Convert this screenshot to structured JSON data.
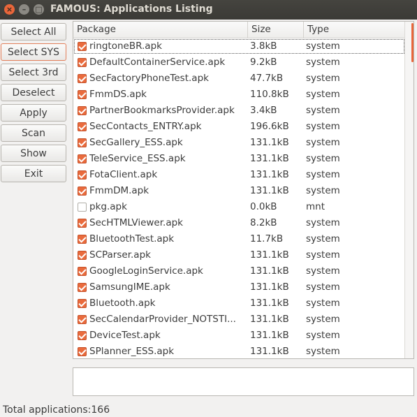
{
  "window": {
    "title": "FAMOUS: Applications Listing",
    "close_glyph": "×",
    "minimize_glyph": "–",
    "maximize_glyph": "□"
  },
  "buttons": [
    {
      "id": "select-all",
      "label": "Select All"
    },
    {
      "id": "select-sys",
      "label": "Select SYS"
    },
    {
      "id": "select-3rd",
      "label": "Select 3rd"
    },
    {
      "id": "deselect",
      "label": "Deselect"
    },
    {
      "id": "apply",
      "label": "Apply"
    },
    {
      "id": "scan",
      "label": "Scan"
    },
    {
      "id": "show",
      "label": "Show"
    },
    {
      "id": "exit",
      "label": "Exit"
    }
  ],
  "table": {
    "columns": [
      "Package",
      "Size",
      "Type"
    ],
    "rows": [
      {
        "checked": true,
        "package": "ringtoneBR.apk",
        "size": "3.8kB",
        "type": "system"
      },
      {
        "checked": true,
        "package": "DefaultContainerService.apk",
        "size": "9.2kB",
        "type": "system"
      },
      {
        "checked": true,
        "package": "SecFactoryPhoneTest.apk",
        "size": "47.7kB",
        "type": "system"
      },
      {
        "checked": true,
        "package": "FmmDS.apk",
        "size": "110.8kB",
        "type": "system"
      },
      {
        "checked": true,
        "package": "PartnerBookmarksProvider.apk",
        "size": "3.4kB",
        "type": "system"
      },
      {
        "checked": true,
        "package": "SecContacts_ENTRY.apk",
        "size": "196.6kB",
        "type": "system"
      },
      {
        "checked": true,
        "package": "SecGallery_ESS.apk",
        "size": "131.1kB",
        "type": "system"
      },
      {
        "checked": true,
        "package": "TeleService_ESS.apk",
        "size": "131.1kB",
        "type": "system"
      },
      {
        "checked": true,
        "package": "FotaClient.apk",
        "size": "131.1kB",
        "type": "system"
      },
      {
        "checked": true,
        "package": "FmmDM.apk",
        "size": "131.1kB",
        "type": "system"
      },
      {
        "checked": false,
        "package": "pkg.apk",
        "size": "0.0kB",
        "type": "mnt"
      },
      {
        "checked": true,
        "package": "SecHTMLViewer.apk",
        "size": "8.2kB",
        "type": "system"
      },
      {
        "checked": true,
        "package": "BluetoothTest.apk",
        "size": "11.7kB",
        "type": "system"
      },
      {
        "checked": true,
        "package": "SCParser.apk",
        "size": "131.1kB",
        "type": "system"
      },
      {
        "checked": true,
        "package": "GoogleLoginService.apk",
        "size": "131.1kB",
        "type": "system"
      },
      {
        "checked": true,
        "package": "SamsungIME.apk",
        "size": "131.1kB",
        "type": "system"
      },
      {
        "checked": true,
        "package": "Bluetooth.apk",
        "size": "131.1kB",
        "type": "system"
      },
      {
        "checked": true,
        "package": "SecCalendarProvider_NOTSTI...",
        "size": "131.1kB",
        "type": "system"
      },
      {
        "checked": true,
        "package": "DeviceTest.apk",
        "size": "131.1kB",
        "type": "system"
      },
      {
        "checked": true,
        "package": "SPlanner_ESS.apk",
        "size": "131.1kB",
        "type": "system"
      }
    ]
  },
  "status": {
    "text": "Total applications:166"
  },
  "colors": {
    "accent": "#e96b3d",
    "titlebar": "#3b3a36",
    "background": "#f2f1f0"
  }
}
